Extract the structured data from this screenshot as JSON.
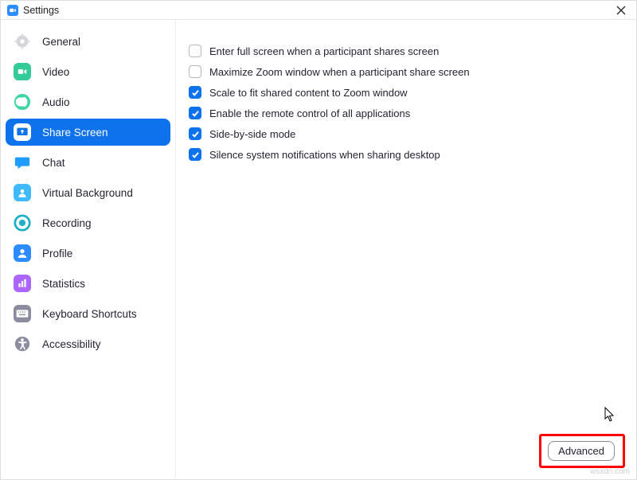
{
  "window": {
    "title": "Settings"
  },
  "sidebar": {
    "items": [
      {
        "key": "general",
        "label": "General"
      },
      {
        "key": "video",
        "label": "Video"
      },
      {
        "key": "audio",
        "label": "Audio"
      },
      {
        "key": "share-screen",
        "label": "Share Screen",
        "active": true
      },
      {
        "key": "chat",
        "label": "Chat"
      },
      {
        "key": "virtual-background",
        "label": "Virtual Background"
      },
      {
        "key": "recording",
        "label": "Recording"
      },
      {
        "key": "profile",
        "label": "Profile"
      },
      {
        "key": "statistics",
        "label": "Statistics"
      },
      {
        "key": "keyboard-shortcuts",
        "label": "Keyboard Shortcuts"
      },
      {
        "key": "accessibility",
        "label": "Accessibility"
      }
    ]
  },
  "options": [
    {
      "label": "Enter full screen when a participant shares screen",
      "checked": false
    },
    {
      "label": "Maximize Zoom window when a participant share screen",
      "checked": false
    },
    {
      "label": "Scale to fit shared content to Zoom window",
      "checked": true
    },
    {
      "label": "Enable the remote control of all applications",
      "checked": true
    },
    {
      "label": "Side-by-side mode",
      "checked": true
    },
    {
      "label": "Silence system notifications when sharing desktop",
      "checked": true
    }
  ],
  "buttons": {
    "advanced": "Advanced"
  },
  "icon_colors": {
    "general": "#d5d5dc",
    "video": "#33cc99",
    "audio": "#42d6a4",
    "share": "#0E72ED",
    "chat": "#1f9cff",
    "vb": "#3fb9ff",
    "recording": "#1fb0c7",
    "profile": "#2d8cff",
    "statistics": "#aa66ff",
    "shortcuts": "#8c8ca0",
    "accessibility": "#8c8ca0"
  },
  "watermark": "wsxdn.com"
}
